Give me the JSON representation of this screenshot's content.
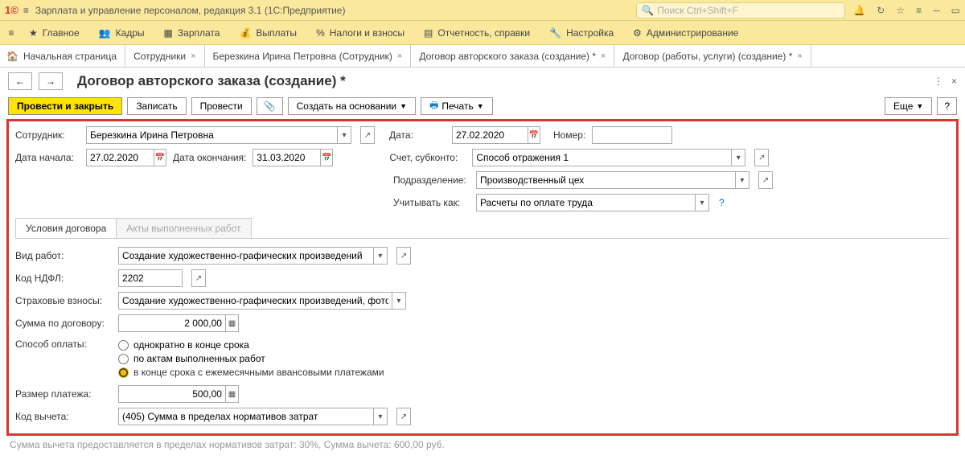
{
  "titlebar": {
    "app_title": "Зарплата и управление персоналом, редакция 3.1  (1С:Предприятие)",
    "search_placeholder": "Поиск Ctrl+Shift+F"
  },
  "mainmenu": {
    "items": [
      {
        "label": "Главное"
      },
      {
        "label": "Кадры"
      },
      {
        "label": "Зарплата"
      },
      {
        "label": "Выплаты"
      },
      {
        "label": "Налоги и взносы"
      },
      {
        "label": "Отчетность, справки"
      },
      {
        "label": "Настройка"
      },
      {
        "label": "Администрирование"
      }
    ]
  },
  "tabs": [
    {
      "label": "Начальная страница"
    },
    {
      "label": "Сотрудники"
    },
    {
      "label": "Березкина Ирина Петровна (Сотрудник)"
    },
    {
      "label": "Договор авторского заказа (создание) *"
    },
    {
      "label": "Договор (работы, услуги) (создание) *"
    }
  ],
  "page": {
    "title": "Договор авторского заказа (создание) *"
  },
  "toolbar": {
    "post_close": "Провести и закрыть",
    "save": "Записать",
    "post": "Провести",
    "create_based": "Создать на основании",
    "print": "Печать",
    "more": "Еще"
  },
  "form": {
    "employee_label": "Сотрудник:",
    "employee_value": "Березкина Ирина Петровна",
    "date_label": "Дата:",
    "date_value": "27.02.2020",
    "number_label": "Номер:",
    "number_value": "",
    "start_label": "Дата начала:",
    "start_value": "27.02.2020",
    "end_label": "Дата окончания:",
    "end_value": "31.03.2020",
    "account_label": "Счет, субконто:",
    "account_value": "Способ отражения 1",
    "department_label": "Подразделение:",
    "department_value": "Производственный цех",
    "consider_label": "Учитывать как:",
    "consider_value": "Расчеты по оплате труда"
  },
  "subtabs": {
    "t1": "Условия договора",
    "t2": "Акты выполненных работ"
  },
  "details": {
    "work_type_label": "Вид работ:",
    "work_type_value": "Создание художественно-графических произведений",
    "ndfl_label": "Код НДФЛ:",
    "ndfl_value": "2202",
    "insurance_label": "Страховые взносы:",
    "insurance_value": "Создание художественно-графических произведений, фотораб",
    "sum_label": "Сумма по договору:",
    "sum_value": "2 000,00",
    "pay_method_label": "Способ оплаты:",
    "pay_opt1": "однократно в конце срока",
    "pay_opt2": "по актам выполненных работ",
    "pay_opt3": "в конце срока с ежемесячными авансовыми платежами",
    "payment_size_label": "Размер платежа:",
    "payment_size_value": "500,00",
    "deduction_label": "Код вычета:",
    "deduction_value": "(405) Сумма в пределах нормативов затрат"
  },
  "footer": "Сумма вычета предоставляется в пределах нормативов затрат: 30%,  Сумма вычета: 600,00 руб."
}
